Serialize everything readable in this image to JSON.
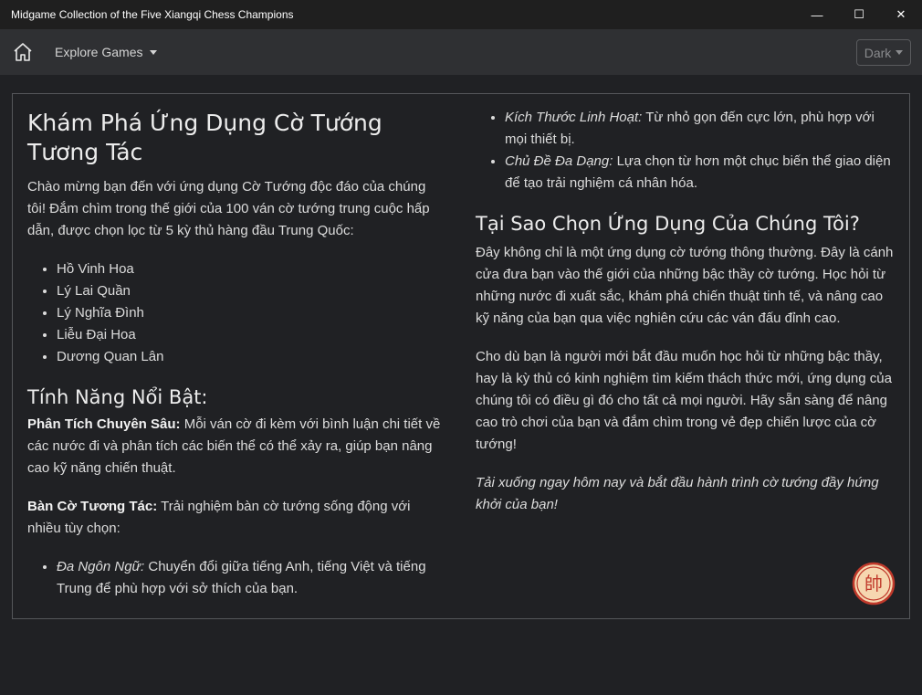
{
  "window": {
    "title": "Midgame Collection of the Five Xiangqi Chess Champions",
    "controls": {
      "minimize": "—",
      "maximize": "☐",
      "close": "✕"
    }
  },
  "navbar": {
    "home_icon": "home-icon",
    "explore_label": "Explore Games",
    "theme_label": "Dark"
  },
  "left": {
    "heading": "Khám Phá Ứng Dụng Cờ Tướng Tương Tác",
    "intro": "Chào mừng bạn đến với ứng dụng Cờ Tướng độc đáo của chúng tôi! Đắm chìm trong thế giới của 100 ván cờ tướng trung cuộc hấp dẫn, được chọn lọc từ 5 kỳ thủ hàng đầu Trung Quốc:",
    "players": [
      "Hồ Vinh Hoa",
      "Lý Lai Quần",
      "Lý Nghĩa Đình",
      "Liễu Đại Hoa",
      "Dương Quan Lân"
    ],
    "features_heading": "Tính Năng Nổi Bật:",
    "analysis_label": "Phân Tích Chuyên Sâu:",
    "analysis_text": " Mỗi ván cờ đi kèm với bình luận chi tiết về các nước đi và phân tích các biến thể có thể xảy ra, giúp bạn nâng cao kỹ năng chiến thuật.",
    "board_label": "Bàn Cờ Tương Tác:",
    "board_text": " Trải nghiệm bàn cờ tướng sống động với nhiều tùy chọn:",
    "options": [
      {
        "label": "Đa Ngôn Ngữ:",
        "text": " Chuyển đổi giữa tiếng Anh, tiếng Việt và tiếng Trung để phù hợp với sở thích của bạn."
      }
    ]
  },
  "right": {
    "options": [
      {
        "label": "Kích Thước Linh Hoạt:",
        "text": " Từ nhỏ gọn đến cực lớn, phù hợp với mọi thiết bị."
      },
      {
        "label": "Chủ Đề Đa Dạng:",
        "text": " Lựa chọn từ hơn một chục biến thể giao diện để tạo trải nghiệm cá nhân hóa."
      }
    ],
    "why_heading": "Tại Sao Chọn Ứng Dụng Của Chúng Tôi?",
    "why_p1": "Đây không chỉ là một ứng dụng cờ tướng thông thường. Đây là cánh cửa đưa bạn vào thế giới của những bậc thầy cờ tướng. Học hỏi từ những nước đi xuất sắc, khám phá chiến thuật tinh tế, và nâng cao kỹ năng của bạn qua việc nghiên cứu các ván đấu đỉnh cao.",
    "why_p2": "Cho dù bạn là người mới bắt đầu muốn học hỏi từ những bậc thầy, hay là kỳ thủ có kinh nghiệm tìm kiếm thách thức mới, ứng dụng của chúng tôi có điều gì đó cho tất cả mọi người. Hãy sẵn sàng để nâng cao trò chơi của bạn và đắm chìm trong vẻ đẹp chiến lược của cờ tướng!",
    "cta": "Tải xuống ngay hôm nay và bắt đầu hành trình cờ tướng đầy hứng khởi của bạn!"
  },
  "emblem": {
    "glyph": "帥",
    "icon": "xiangqi-general-piece-icon",
    "color": "#c0392b",
    "fill": "#f6d7b0"
  }
}
